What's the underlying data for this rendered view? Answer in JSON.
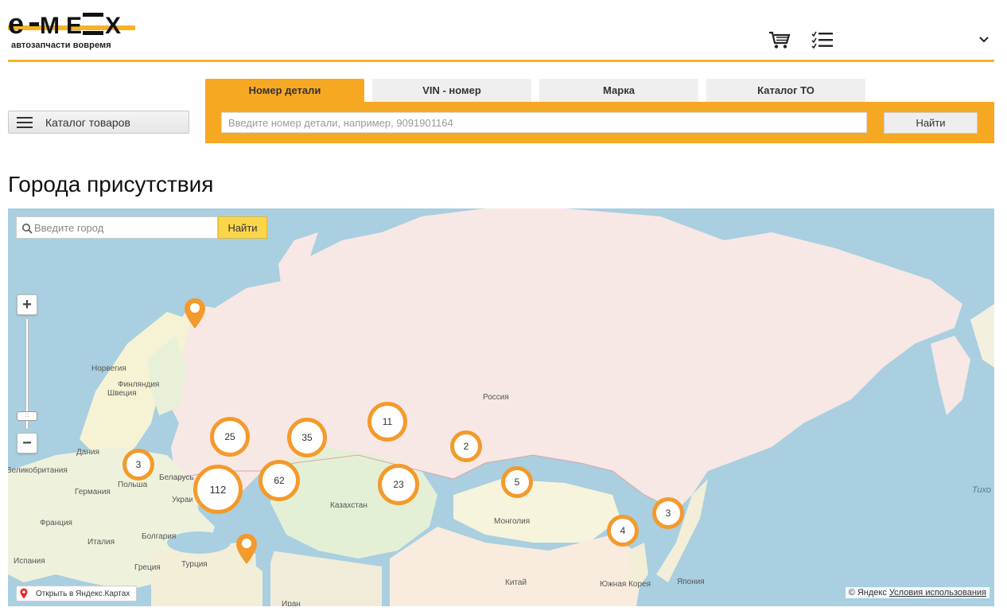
{
  "header": {
    "logo_text": "e-MEX",
    "logo_subtitle": "автозапчасти вовремя",
    "icons": [
      "cart-icon",
      "checklist-icon"
    ],
    "user_name": "",
    "accent_color": "#f7b324"
  },
  "catalog": {
    "label": "Каталог товаров"
  },
  "search": {
    "tabs": [
      {
        "label": "Номер детали",
        "active": true
      },
      {
        "label": "VIN - номер",
        "active": false
      },
      {
        "label": "Марка",
        "active": false
      },
      {
        "label": "Каталог ТО",
        "active": false
      }
    ],
    "placeholder": "Введите номер детали, например, 9091901164",
    "button_label": "Найти",
    "panel_color": "#f7a823"
  },
  "page_title": "Города присутствия",
  "map": {
    "city_search": {
      "placeholder": "Введите город",
      "button_label": "Найти"
    },
    "zoom": {
      "in_label": "+",
      "out_label": "−"
    },
    "labels": {
      "russia": "Россия",
      "norway": "Норвегия",
      "finland": "Финляндия",
      "sweden": "Швеция",
      "denmark": "Дания",
      "uk": "Великобритания",
      "poland": "Польша",
      "belarus": "Беларусь",
      "germany": "Германия",
      "ukraine": "Украина",
      "france": "Франция",
      "italy": "Италия",
      "bulgaria": "Болгария",
      "spain": "Испания",
      "greece": "Греция",
      "turkey": "Турция",
      "kazakhstan": "Казахстан",
      "mongolia": "Монголия",
      "china": "Китай",
      "south_korea": "Южная Корея",
      "japan": "Япония",
      "iran": "Иран",
      "pacific": "Тихо"
    },
    "clusters": [
      {
        "count": "25"
      },
      {
        "count": "35"
      },
      {
        "count": "11"
      },
      {
        "count": "2"
      },
      {
        "count": "3"
      },
      {
        "count": "112"
      },
      {
        "count": "62"
      },
      {
        "count": "23"
      },
      {
        "count": "5"
      },
      {
        "count": "3"
      },
      {
        "count": "4"
      }
    ],
    "cluster_color": "#f39a2b",
    "open_in_yandex": "Открыть в Яндекс.Картах",
    "copyright": "© Яндекс",
    "terms": "Условия использования"
  }
}
